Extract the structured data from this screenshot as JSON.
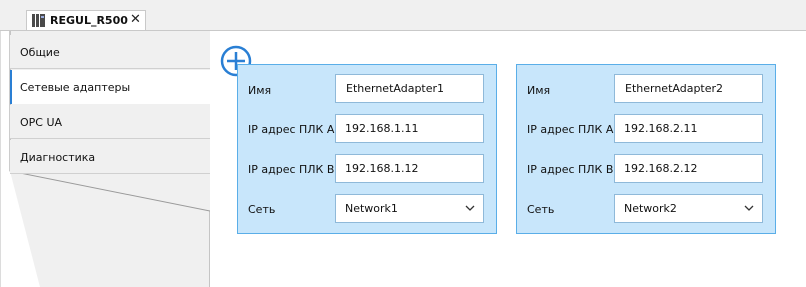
{
  "tabs": [
    {
      "title": "REGUL_R500",
      "close_glyph": "✕",
      "icon": "module-icon"
    }
  ],
  "nav": {
    "items": [
      {
        "label": "Общие",
        "active": false
      },
      {
        "label": "Сетевые адаптеры",
        "active": true
      },
      {
        "label": "OPC UA",
        "active": false
      },
      {
        "label": "Диагностика",
        "active": false
      }
    ]
  },
  "add_button": {
    "icon": "add-circle-icon"
  },
  "adapters": [
    {
      "name_label": "Имя",
      "name": "EthernetAdapter1",
      "ip_a_label": "IP адрес ПЛК A",
      "ip_a": "192.168.1.11",
      "ip_b_label": "IP адрес ПЛК B",
      "ip_b": "192.168.1.12",
      "network_label": "Сеть",
      "network": "Network1"
    },
    {
      "name_label": "Имя",
      "name": "EthernetAdapter2",
      "ip_a_label": "IP адрес ПЛК A",
      "ip_a": "192.168.2.11",
      "ip_b_label": "IP адрес ПЛК B",
      "ip_b": "192.168.2.12",
      "network_label": "Сеть",
      "network": "Network2"
    }
  ],
  "colors": {
    "card_bg": "#c8e6fb",
    "card_border": "#5aaee8",
    "accent": "#2a7fd4",
    "panel_bg": "#f0f0f0"
  }
}
